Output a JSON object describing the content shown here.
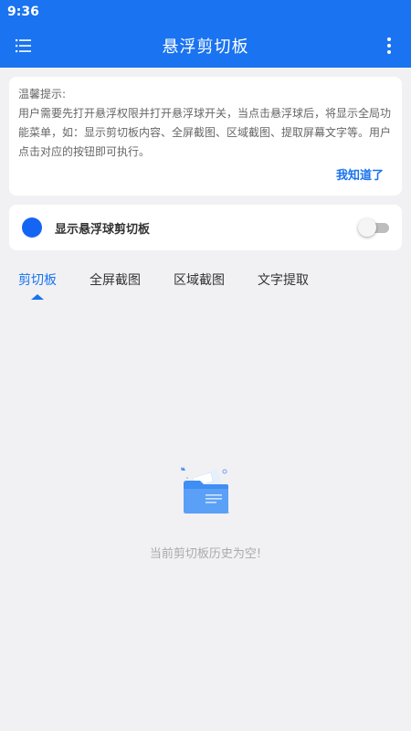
{
  "status_bar": {
    "time": "9:36"
  },
  "app_bar": {
    "title": "悬浮剪切板",
    "menu_icon": "list-menu-icon",
    "more_icon": "more-vertical-icon",
    "color": "#1a73f0"
  },
  "notice": {
    "title": "温馨提示:",
    "body": "用户需要先打开悬浮权限并打开悬浮球开关，当点击悬浮球后，将显示全局功能菜单，如：显示剪切板内容、全屏截图、区域截图、提取屏幕文字等。用户点击对应的按钮即可执行。",
    "action": "我知道了"
  },
  "float_toggle": {
    "label": "显示悬浮球剪切板",
    "enabled": false,
    "dot_color": "#1565f5"
  },
  "tabs": [
    {
      "label": "剪切板",
      "active": true
    },
    {
      "label": "全屏截图",
      "active": false
    },
    {
      "label": "区域截图",
      "active": false
    },
    {
      "label": "文字提取",
      "active": false
    }
  ],
  "empty_state": {
    "icon": "empty-folder-icon",
    "message": "当前剪切板历史为空!"
  }
}
